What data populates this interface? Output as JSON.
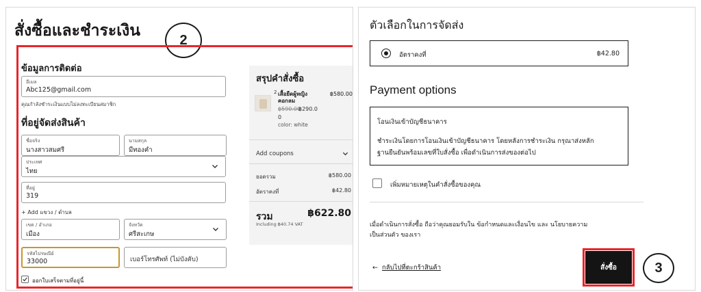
{
  "checkout": {
    "title": "สั่งซื้อและชำระเงิน"
  },
  "callouts": {
    "form": "2",
    "order": "3"
  },
  "contact": {
    "heading": "ข้อมูลการติดต่อ",
    "email_label": "อีเมล",
    "email_value": "Abc125@gmail.com",
    "guest_note": "คุณกำลังชำระเงินแบบไม่ลงทะเบียนสมาชิก"
  },
  "shipping": {
    "heading": "ที่อยู่จัดส่งสินค้า",
    "first_name_label": "ชื่อจริง",
    "first_name_value": "นางสาวสมศรี",
    "last_name_label": "นามสกุล",
    "last_name_value": "มีทองคำ",
    "country_label": "ประเทศ",
    "country_value": "ไทย",
    "address_label": "ที่อยู่",
    "address_value": "319",
    "add_area_link": "+ Add แขวง / ตำบล",
    "district_label": "เขต / อำเภอ",
    "district_value": "เมือง",
    "province_label": "จังหวัด",
    "province_value": "ศรีสะเกษ",
    "postal_label": "รหัสไปรษณีย์",
    "postal_value": "33000",
    "phone_placeholder": "เบอร์โทรศัพท์ (ไม่บังคับ)",
    "invoice_label": "ออกใบเสร็จตามที่อยู่นี้"
  },
  "summary": {
    "title": "สรุปคำสั่งซื้อ",
    "item_qty": "2",
    "item_name": "เสื้อยืดผู้หญิง คอกลม",
    "item_price": "฿580.00",
    "item_old_price": "฿590.00",
    "item_new_price": "฿290.0",
    "item_zero": "0",
    "item_color": "color: white",
    "coupons_label": "Add coupons",
    "subtotal_label": "ยอดรวม",
    "subtotal_value": "฿580.00",
    "shipping_label": "อัตราคงที่",
    "shipping_value": "฿42.80",
    "total_label": "รวม",
    "total_value": "฿622.80",
    "vat_note": "Including ฿40.74 VAT"
  },
  "shipping_options": {
    "heading": "ตัวเลือกในการจัดส่ง",
    "option_label": "อัตราคงที่",
    "option_price": "฿42.80"
  },
  "payment": {
    "heading": "Payment options",
    "method_title": "โอนเงินเข้าบัญชีธนาคาร",
    "method_desc_line1": "ชำระเงินโดยการโอนเงินเข้าบัญชีธนาคาร โดยหลังการชำระเงิน กรุณาส่งหลัก",
    "method_desc_line2": "ฐานยืนยันพร้อมเลขที่ใบสั่งซื้อ เพื่อดำเนินการส่งของต่อไป",
    "add_note_label": "เพิ่มหมายเหตุในคำสั่งซื้อของคุณ"
  },
  "terms": {
    "line1": "เมื่อดำเนินการสั่งซื้อ ถือว่าคุณยอมรับใน ข้อกำหนดและเงื่อนไข และ นโยบายความ",
    "line2": "เป็นส่วนตัว ของเรา"
  },
  "actions": {
    "back_label": "กลับไปที่ตะกร้าสินค้า",
    "order_label": "สั่งซื้อ"
  },
  "colors": {
    "highlight": "#e8252b",
    "button_bg": "#141414",
    "focus_border": "#c8962e"
  }
}
